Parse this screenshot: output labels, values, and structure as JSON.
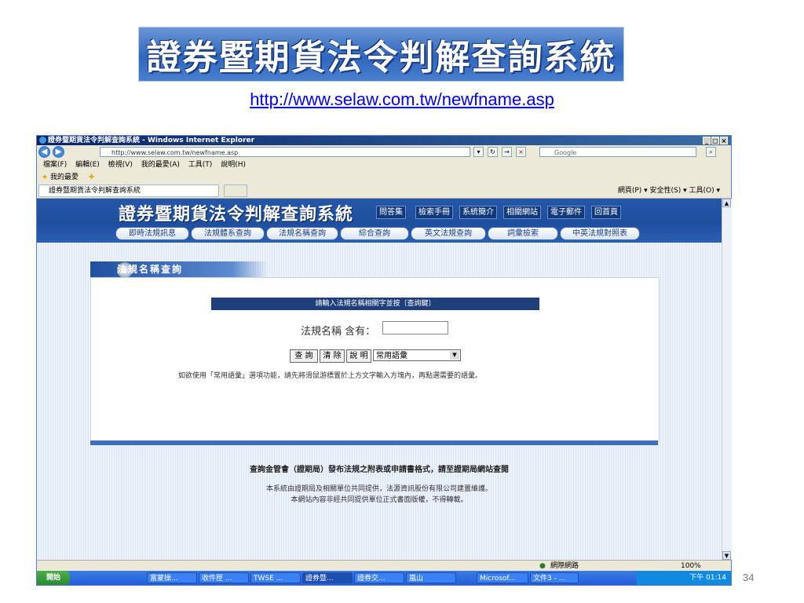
{
  "slide": {
    "banner_title": "證券暨期貨法令判解查詢系統",
    "url": "http://www.selaw.com.tw/newfname.asp",
    "page_number": "34"
  },
  "window": {
    "title": "證券暨期貨法令判解查詢系統 - Windows Internet Explorer",
    "controls": [
      "_",
      "□",
      "×"
    ]
  },
  "address_bar": {
    "url": "http://www.selaw.com.tw/newfname.asp",
    "search_placeholder": "Google"
  },
  "menu": {
    "items": [
      "檔案(F)",
      "編輯(E)",
      "檢視(V)",
      "我的最愛(A)",
      "工具(T)",
      "說明(H)"
    ]
  },
  "favorites": {
    "label": "我的最愛"
  },
  "tab": {
    "label": "證券暨期貨法令判解查詢系統"
  },
  "command_bar": {
    "text": "網頁(P) ▾  安全性(S) ▾  工具(O) ▾"
  },
  "site": {
    "logo": "證券暨期貨法令判解查詢系統",
    "top_nav": [
      "問答集",
      "檢索手冊",
      "系統簡介",
      "相關網站",
      "電子郵件",
      "回首頁"
    ],
    "nav": [
      "即時法規訊息",
      "法規體系查詢",
      "法規名稱查詢",
      "綜合查詢",
      "英文法規查詢",
      "詞彙檢索",
      "中英法規對照表"
    ]
  },
  "section": {
    "title": "法規名稱查詢"
  },
  "form": {
    "header": "請輸入法規名稱相關字並按〔查詢鍵〕",
    "field_label": "法規名稱 含有：",
    "field_value": "",
    "buttons": [
      "查 詢",
      "清 除",
      "說 明"
    ],
    "select_value": "常用語彙",
    "hint": "如欲使用「常用語彙」選項功能，請先將滑鼠游標置於上方文字輸入方塊內，再點選需要的語彙。"
  },
  "footer": {
    "line1": "查詢金管會（證期局）發布法規之附表或申請書格式，請至證期局網站查閱",
    "line2": "本系統由證期局及相關單位共同提供，法源資訊股份有限公司建置維護。",
    "line3": "本網站內容非經共同提供單位正式書面版權，不得轉載。"
  },
  "status_bar": {
    "zone": "網際網路",
    "zoom": "100%"
  },
  "taskbar": {
    "start": "開始",
    "buttons": [
      "富蒙操...",
      "收件匣 ...",
      "TWSE ...",
      "證券暨...",
      "證券交...",
      "嵐山",
      "Microsof...",
      "文件3 - ..."
    ],
    "clock": "下午 01:14"
  }
}
